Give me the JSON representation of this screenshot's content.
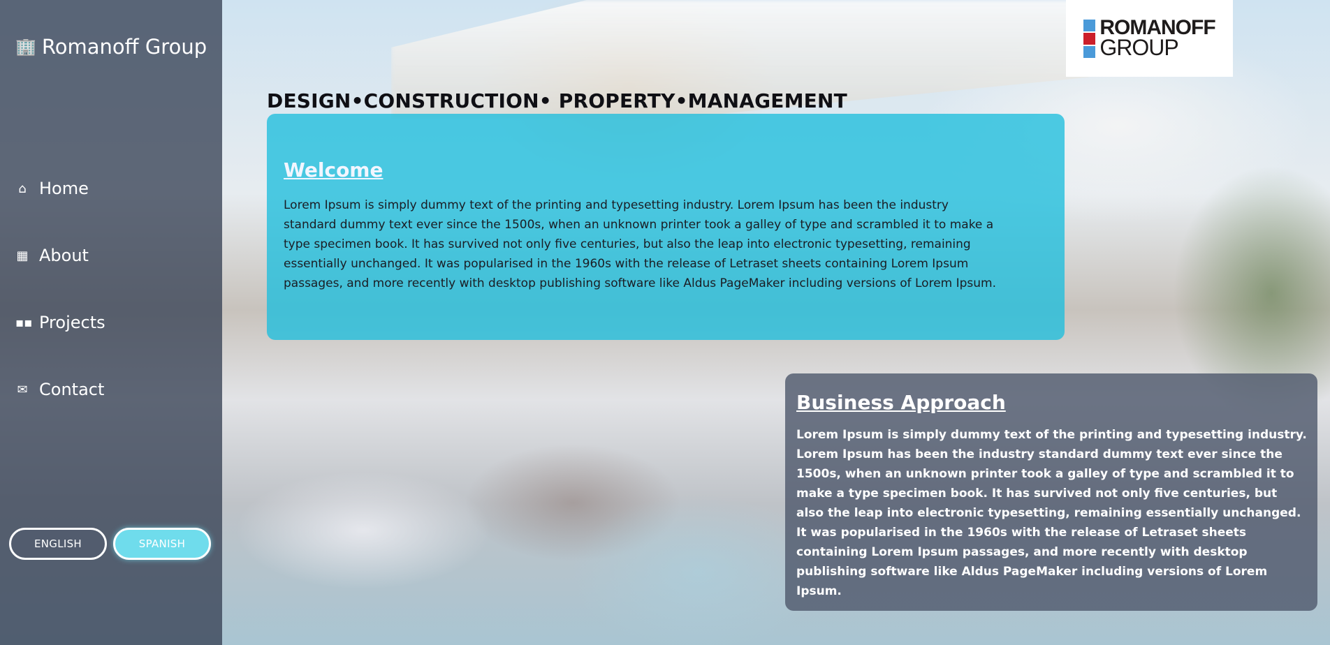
{
  "sidebar": {
    "brand": {
      "icon": "building-icon",
      "text": "Romanoff Group"
    },
    "items": [
      {
        "icon": "home-icon",
        "label": "Home"
      },
      {
        "icon": "office-icon",
        "label": "About"
      },
      {
        "icon": "grid-icon",
        "label": "Projects"
      },
      {
        "icon": "envelope-icon",
        "label": "Contact"
      }
    ],
    "languages": {
      "english": "ENGLISH",
      "spanish": "SPANISH"
    }
  },
  "header": {
    "tagline": "DESIGN•CONSTRUCTION• PROPERTY•MANAGEMENT",
    "logo": {
      "line1": "ROMANOFF",
      "line2": "GROUP",
      "square_colors": [
        "#4a9ad9",
        "#cc1f2a",
        "#4a9ad9"
      ]
    }
  },
  "welcome": {
    "title": "Welcome",
    "body": "Lorem Ipsum is simply dummy text of the printing and typesetting industry. Lorem Ipsum has been the industry standard dummy text ever since the 1500s, when an unknown printer took a galley of type and scrambled it to make a type specimen book. It has survived not only five centuries, but also the leap into electronic typesetting, remaining essentially unchanged. It was popularised in the 1960s with the release of Letraset sheets containing Lorem Ipsum passages, and more recently with desktop publishing software like Aldus PageMaker including versions of Lorem Ipsum."
  },
  "approach": {
    "title": "Business Approach",
    "body": "Lorem Ipsum is simply dummy text of the printing and typesetting industry. Lorem Ipsum has been the industry standard dummy text ever since the 1500s, when an unknown printer took a galley of type and scrambled it to make a type specimen book. It has survived not only five centuries, but also the leap into electronic typesetting, remaining essentially unchanged. It was popularised in the 1960s with the release of Letraset sheets containing Lorem Ipsum passages, and more recently with desktop publishing software like Aldus PageMaker including versions of Lorem Ipsum."
  },
  "colors": {
    "accent_cyan": "#1ebedc",
    "sidebar_bg": "#374155",
    "spanish_button": "#6fdcec"
  }
}
